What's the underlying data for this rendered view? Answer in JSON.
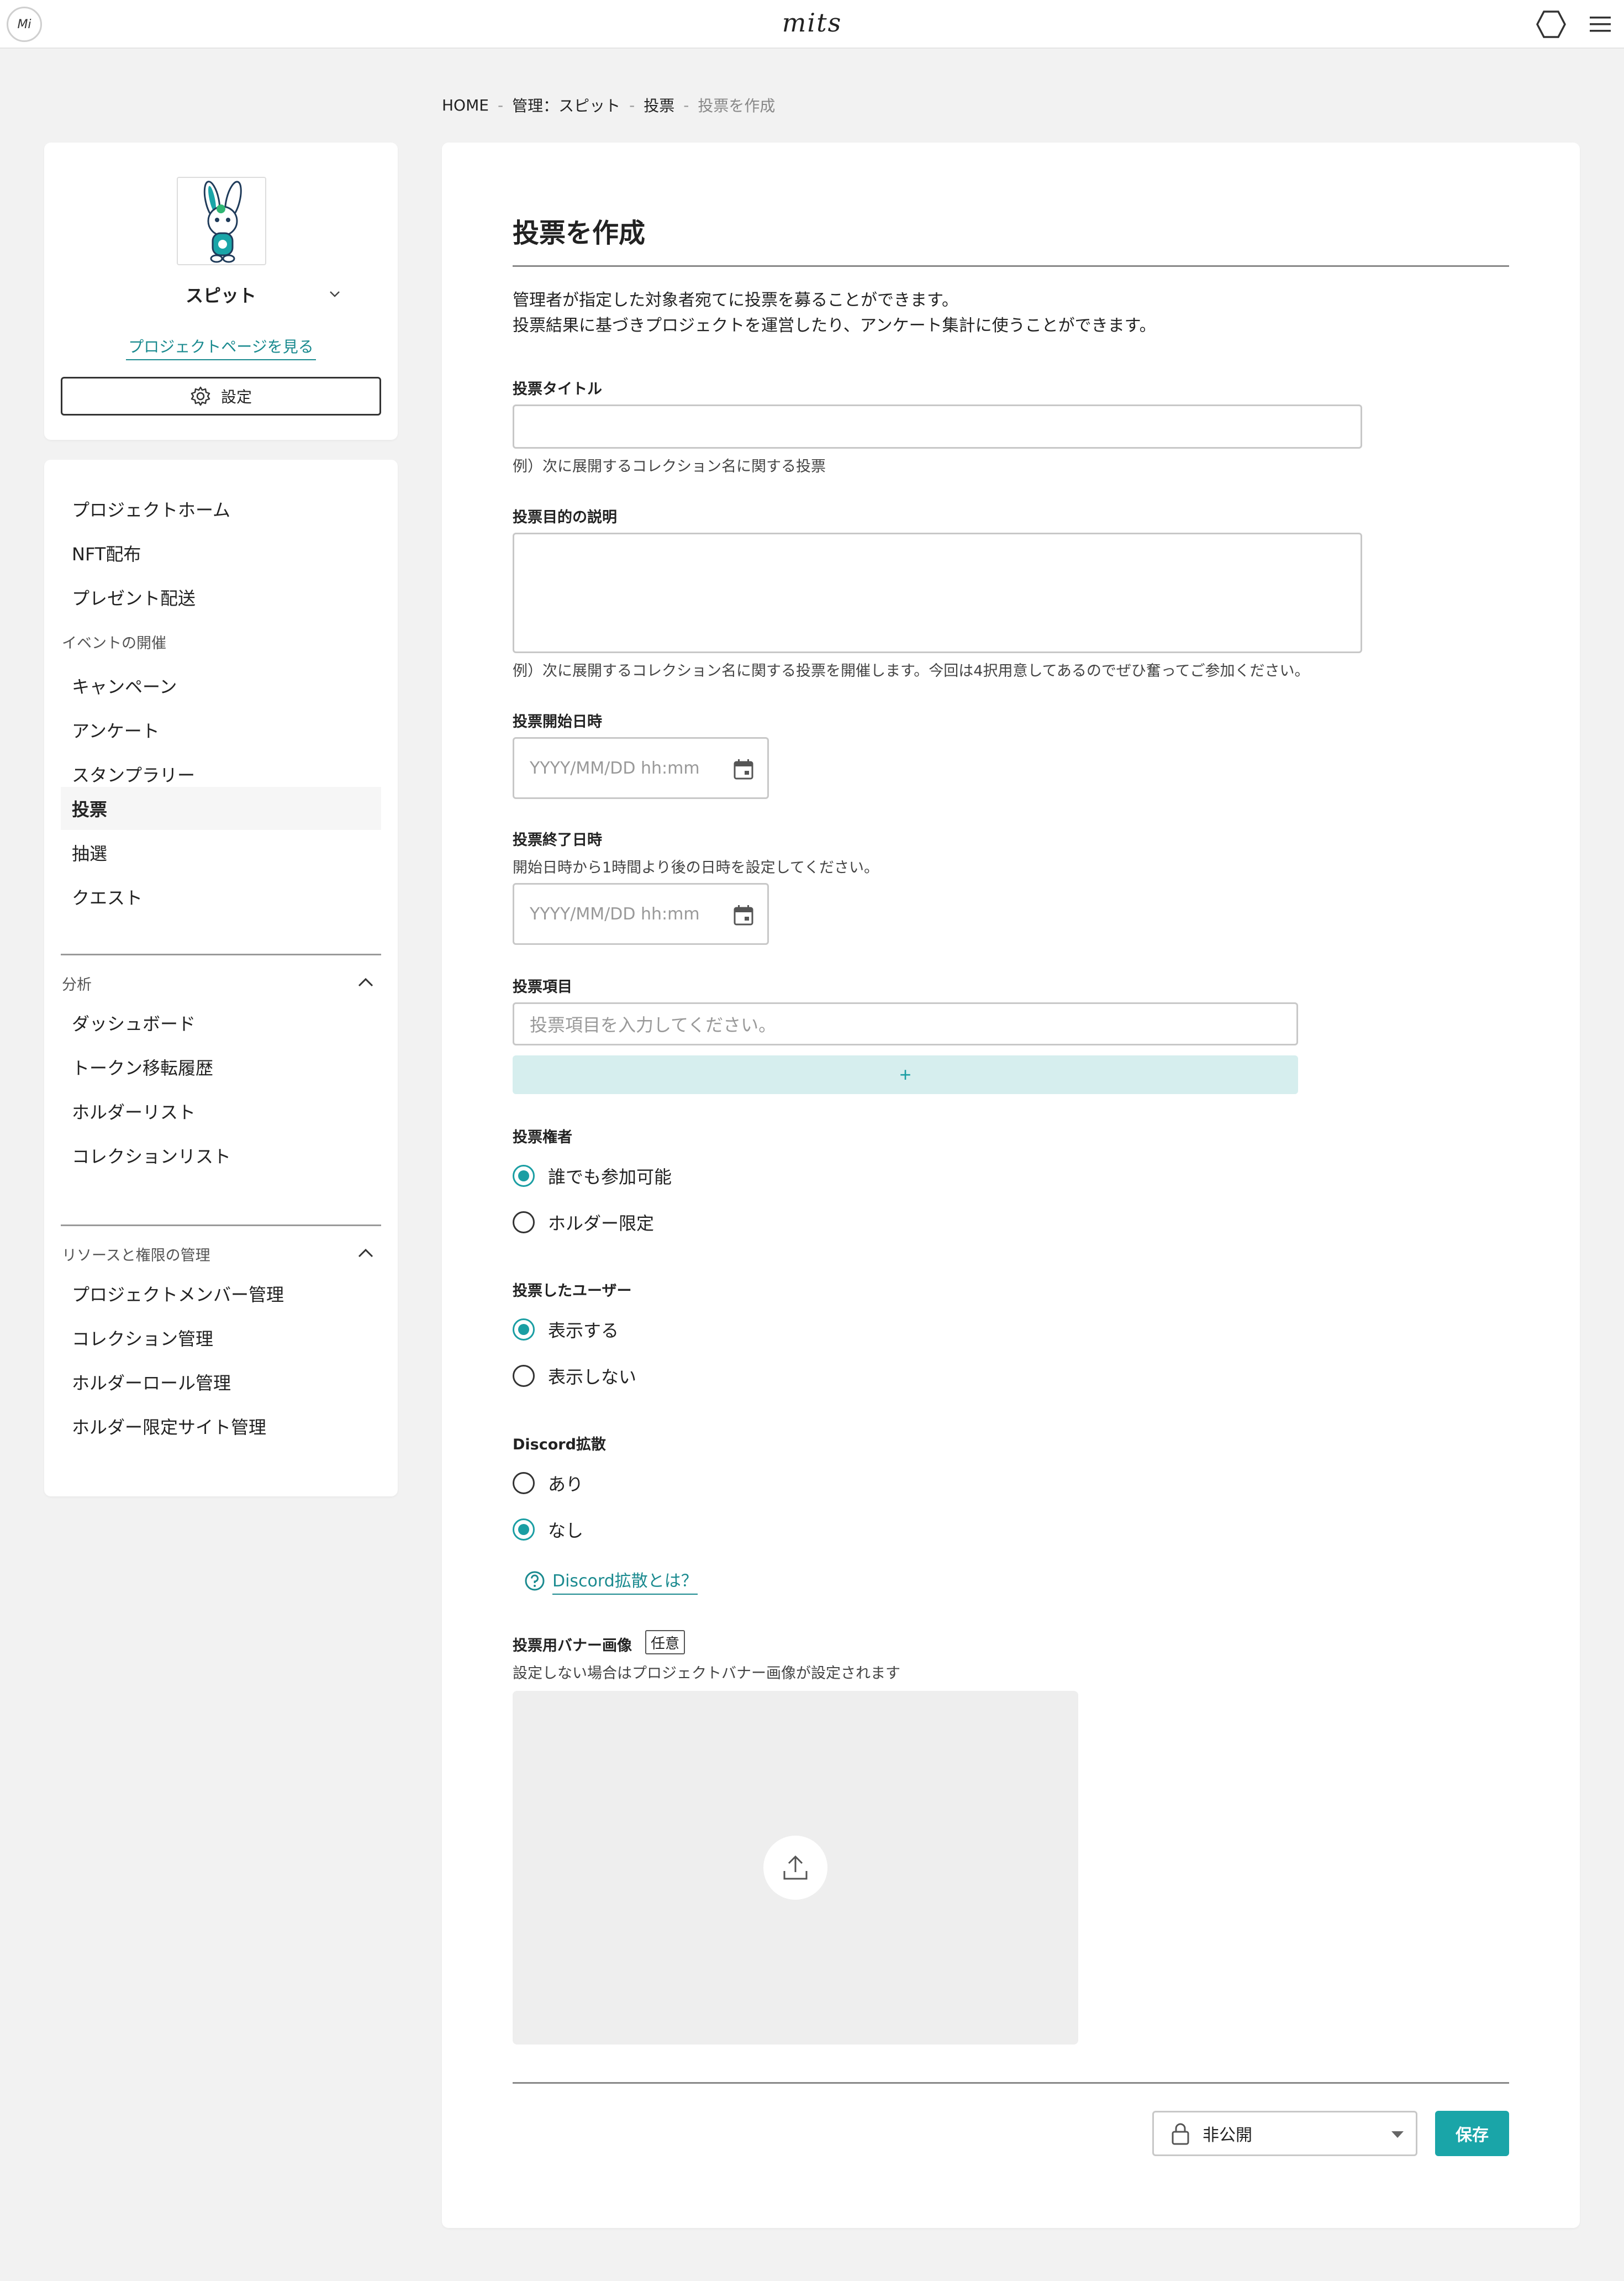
{
  "header": {
    "logo_text": "Mi",
    "brand": "mits"
  },
  "breadcrumb": [
    "HOME",
    "管理：スピット",
    "投票",
    "投票を作成"
  ],
  "breadcrumb_sep": "-",
  "sidebar": {
    "project_name": "スピット",
    "project_link": "プロジェクトページを見る",
    "settings_label": "設定",
    "top_items": [
      "プロジェクトホーム",
      "NFT配布",
      "プレゼント配送"
    ],
    "events_label": "イベントの開催",
    "event_items": [
      "キャンペーン",
      "アンケート",
      "スタンプラリー",
      "投票",
      "抽選",
      "クエスト"
    ],
    "active_item": "投票",
    "analysis_label": "分析",
    "analysis_items": [
      "ダッシュボード",
      "トークン移転履歴",
      "ホルダーリスト",
      "コレクションリスト"
    ],
    "resources_label": "リソースと権限の管理",
    "resource_items": [
      "プロジェクトメンバー管理",
      "コレクション管理",
      "ホルダーロール管理",
      "ホルダー限定サイト管理"
    ]
  },
  "form": {
    "title": "投票を作成",
    "description": [
      "管理者が指定した対象者宛てに投票を募ることができます。",
      "投票結果に基づきプロジェクトを運営したり、アンケート集計に使うことができます。"
    ],
    "vote_title": {
      "label": "投票タイトル",
      "value": "",
      "hint": "例）次に展開するコレクション名に関する投票"
    },
    "purpose": {
      "label": "投票目的の説明",
      "value": "",
      "hint": "例）次に展開するコレクション名に関する投票を開催します。今回は4択用意してあるのでぜひ奮ってご参加ください。"
    },
    "start": {
      "label": "投票開始日時",
      "placeholder": "YYYY/MM/DD hh:mm"
    },
    "end": {
      "label": "投票終了日時",
      "hint": "開始日時から1時間より後の日時を設定してください。",
      "placeholder": "YYYY/MM/DD hh:mm"
    },
    "items": {
      "label": "投票項目",
      "placeholder": "投票項目を入力してください。",
      "add_symbol": "+"
    },
    "eligibility": {
      "label": "投票権者",
      "options": [
        "誰でも参加可能",
        "ホルダー限定"
      ],
      "selected": "誰でも参加可能"
    },
    "voters": {
      "label": "投票したユーザー",
      "options": [
        "表示する",
        "表示しない"
      ],
      "selected": "表示する"
    },
    "discord": {
      "label": "Discord拡散",
      "options": [
        "あり",
        "なし"
      ],
      "selected": "なし",
      "help_link": "Discord拡散とは？"
    },
    "banner": {
      "label": "投票用バナー画像",
      "badge": "任意",
      "hint": "設定しない場合はプロジェクトバナー画像が設定されます"
    },
    "visibility": "非公開",
    "save_label": "保存"
  },
  "colors": {
    "accent": "#1aa5a8",
    "link": "#1a8a8f",
    "add_button_bg": "#d6eeee"
  }
}
